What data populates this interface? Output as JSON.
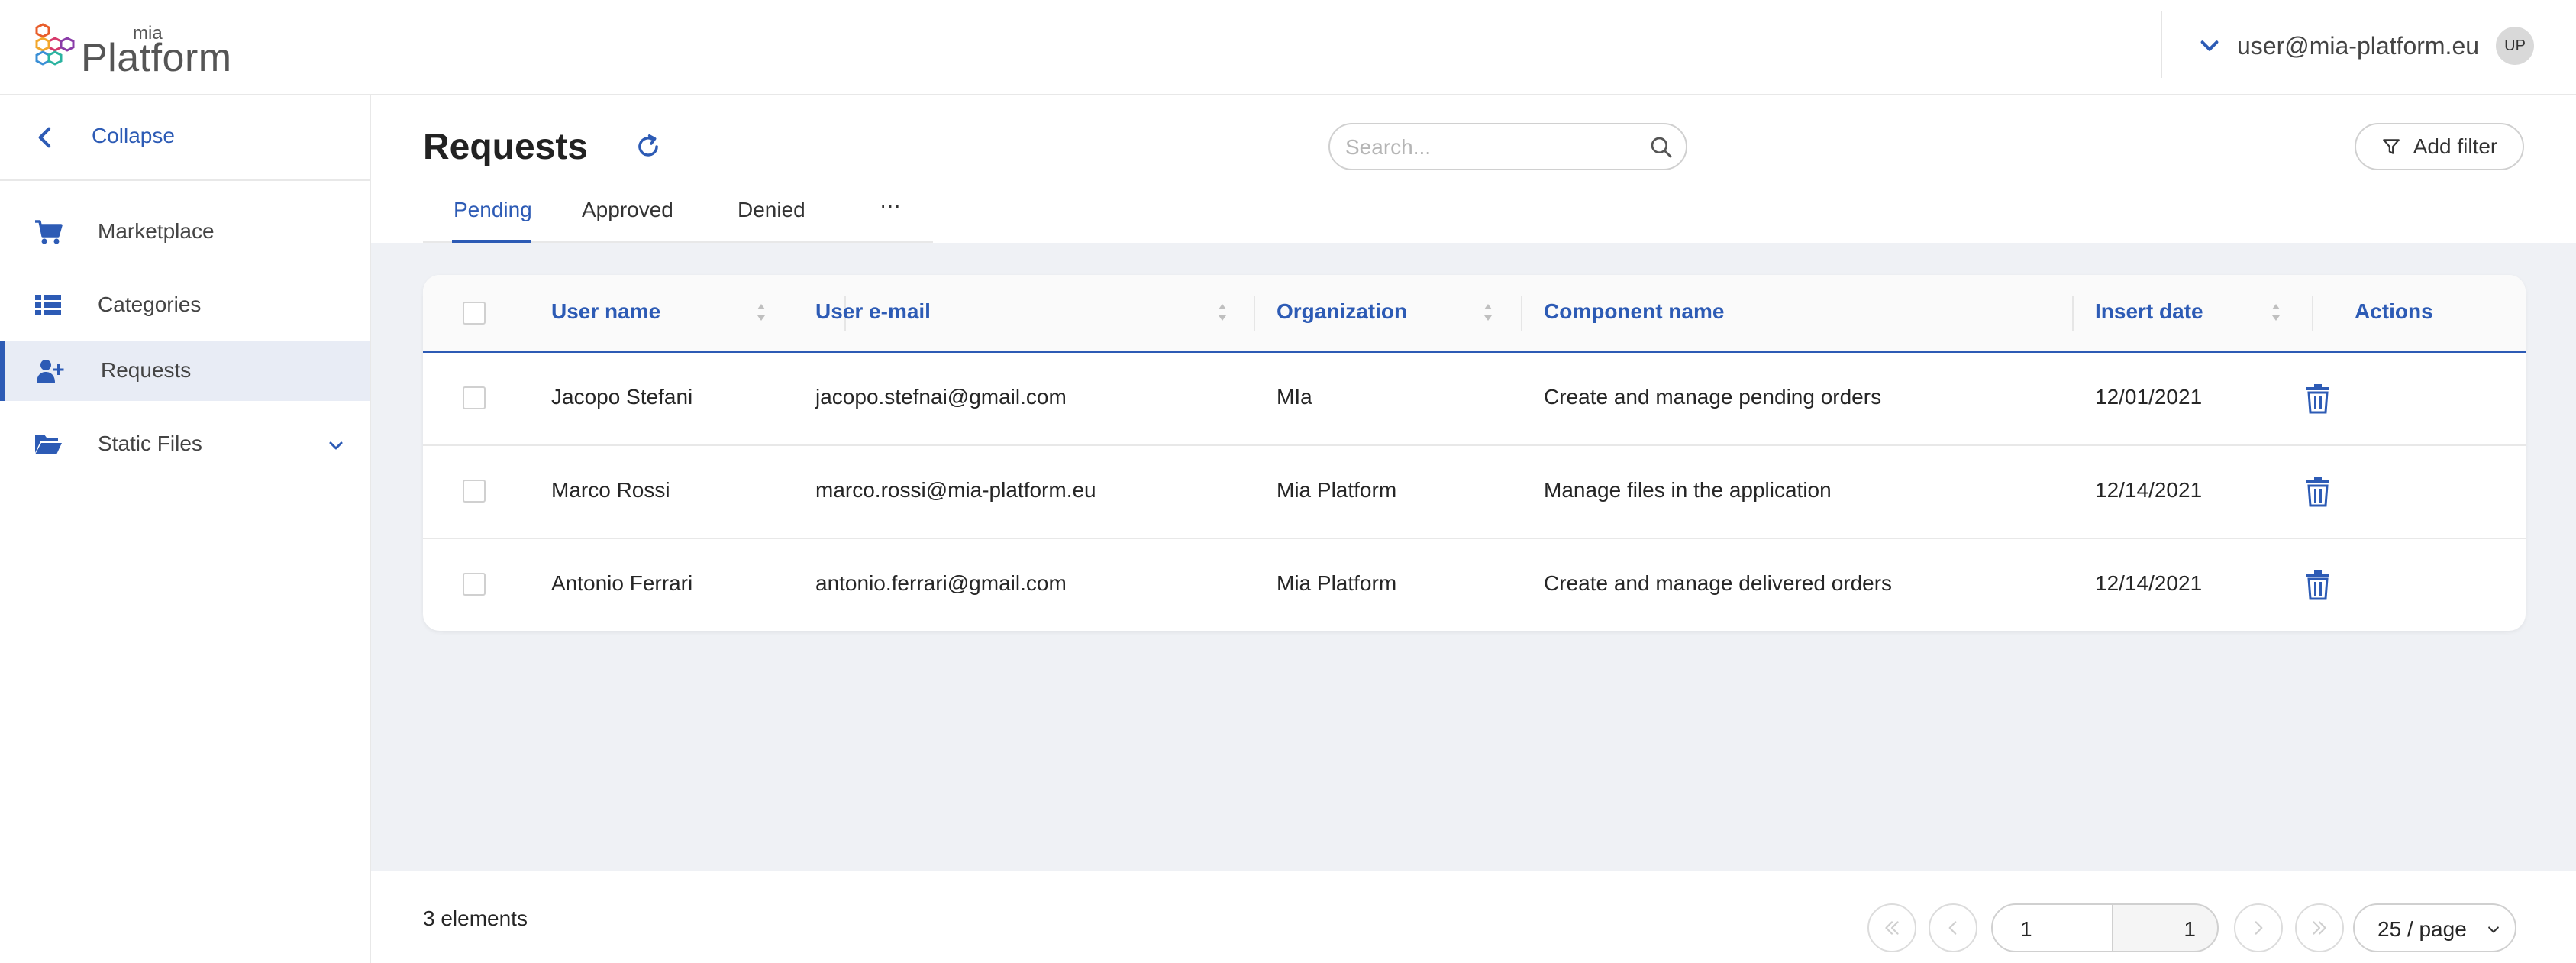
{
  "header": {
    "logo_small": "mia",
    "logo_big": "Platform",
    "user_email": "user@mia-platform.eu",
    "user_initials": "UP"
  },
  "sidebar": {
    "collapse_label": "Collapse",
    "items": [
      {
        "label": "Marketplace",
        "icon": "cart-icon"
      },
      {
        "label": "Categories",
        "icon": "list-icon"
      },
      {
        "label": "Requests",
        "icon": "user-plus-icon",
        "active": true
      },
      {
        "label": "Static Files",
        "icon": "folder-open-icon",
        "expandable": true
      }
    ]
  },
  "main": {
    "title": "Requests",
    "search_placeholder": "Search...",
    "add_filter_label": "Add filter",
    "tabs": [
      {
        "label": "Pending",
        "active": true
      },
      {
        "label": "Approved"
      },
      {
        "label": "Denied"
      },
      {
        "label": "···"
      }
    ]
  },
  "table": {
    "columns": [
      "User name",
      "User e-mail",
      "Organization",
      "Component name",
      "Insert date",
      "Actions"
    ],
    "rows": [
      [
        "Jacopo Stefani",
        "jacopo.stefnai@gmail.com",
        "MIa",
        "Create and manage pending orders",
        "12/01/2021"
      ],
      [
        "Marco Rossi",
        "marco.rossi@mia-platform.eu",
        "Mia Platform",
        "Manage files in the application",
        "12/14/2021"
      ],
      [
        "Antonio Ferrari",
        "antonio.ferrari@gmail.com",
        "Mia Platform",
        "Create and manage delivered orders",
        "12/14/2021"
      ]
    ]
  },
  "footer": {
    "count_text": "3 elements",
    "current_page": "1",
    "total_pages": "1",
    "page_size": "25 / page"
  },
  "colors": {
    "accent": "#2d5bb5",
    "active_bg": "#e8ecf5",
    "content_bg": "#eff1f5"
  }
}
